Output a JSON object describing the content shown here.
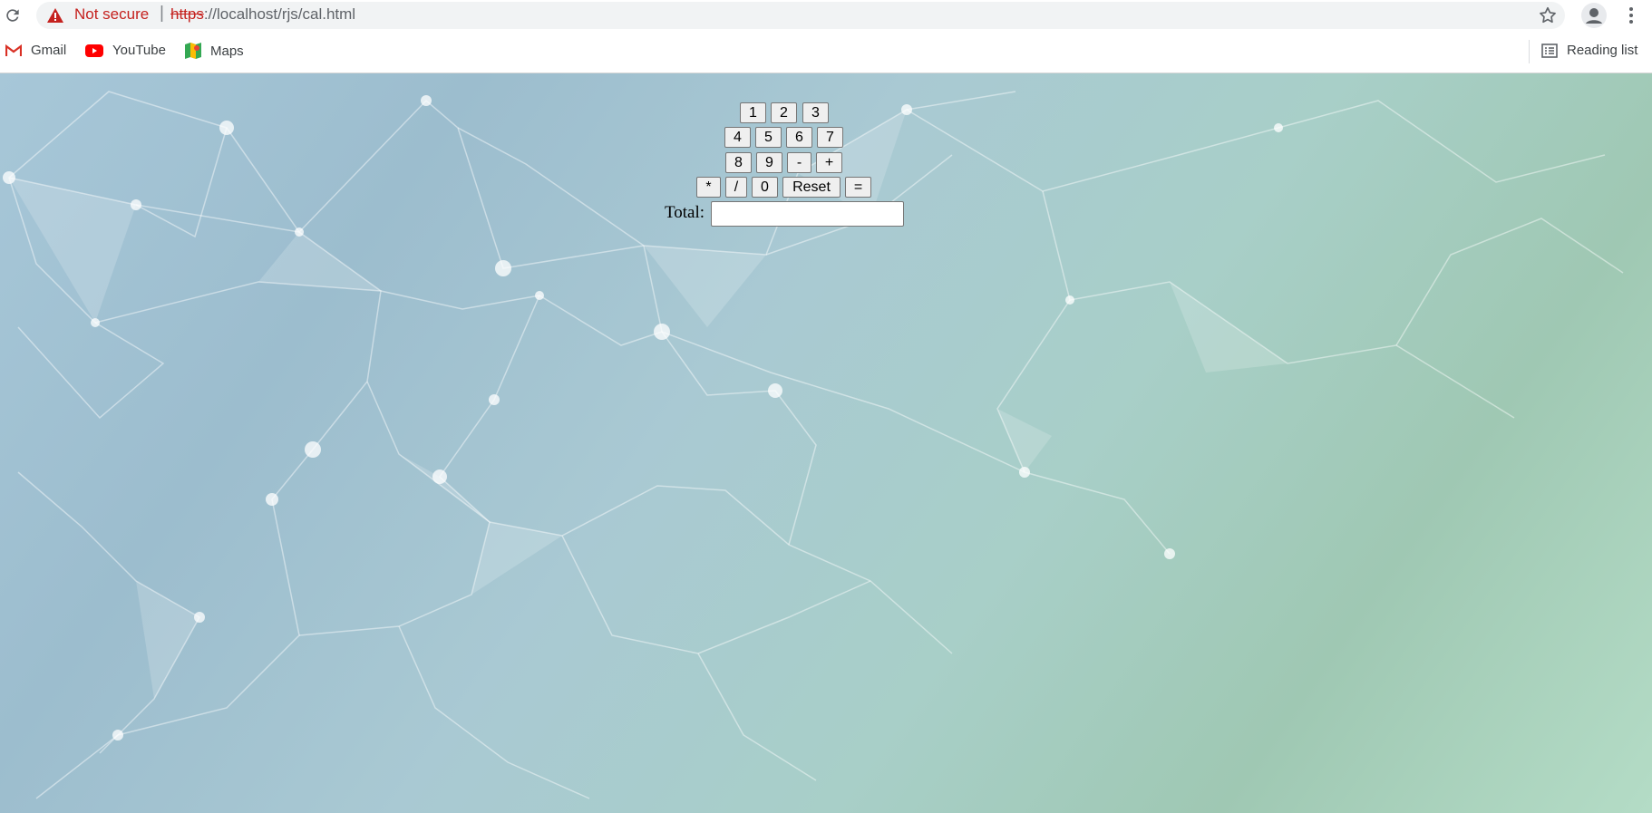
{
  "browser": {
    "security_label": "Not secure",
    "url_scheme": "https",
    "url_rest": "://localhost/rjs/cal.html",
    "icons": [
      "reload-icon",
      "warning-icon",
      "star-icon",
      "profile-icon",
      "kebab-menu-icon"
    ]
  },
  "bookmarks": [
    {
      "label": "Gmail",
      "icon": "gmail-icon"
    },
    {
      "label": "YouTube",
      "icon": "youtube-icon"
    },
    {
      "label": "Maps",
      "icon": "maps-icon"
    }
  ],
  "reading_list": {
    "label": "Reading list",
    "icon": "reading-list-icon"
  },
  "calculator": {
    "row1": [
      "1",
      "2",
      "3"
    ],
    "row2": [
      "4",
      "5",
      "6",
      "7"
    ],
    "row3": [
      "8",
      "9",
      "-",
      "+"
    ],
    "row4": [
      "*",
      "/",
      "0",
      "Reset",
      "="
    ],
    "total_label": "Total:",
    "total_value": ""
  }
}
